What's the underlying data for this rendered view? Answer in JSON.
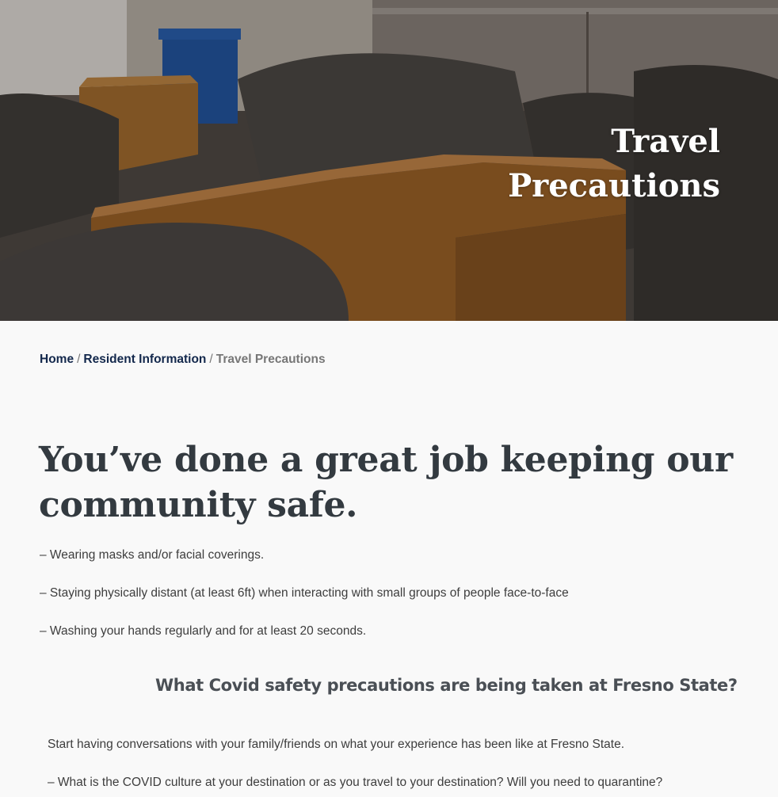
{
  "hero": {
    "title_line1": "Travel",
    "title_line2": "Precautions"
  },
  "breadcrumb": {
    "home": "Home",
    "separator": "/",
    "section": "Resident Information",
    "current": "Travel Precautions"
  },
  "main": {
    "headline": "You’ve done a great job keeping our community safe.",
    "tips": [
      "– Wearing masks and/or facial coverings.",
      "– Staying physically distant (at least 6ft) when interacting with small groups of people face-to-face",
      "– Washing your hands regularly and for at least 20 seconds."
    ],
    "subheading": "What Covid safety precautions are being taken at Fresno State?",
    "paragraph1": "Start having conversations with your family/friends on what your experience has been like at Fresno State.",
    "paragraph2": "– What is the COVID culture at your destination or as you travel to your destination? Will you need to quarantine?"
  },
  "colors": {
    "link": "#13284c",
    "headline": "#333a40",
    "background": "#f9f9f9"
  }
}
